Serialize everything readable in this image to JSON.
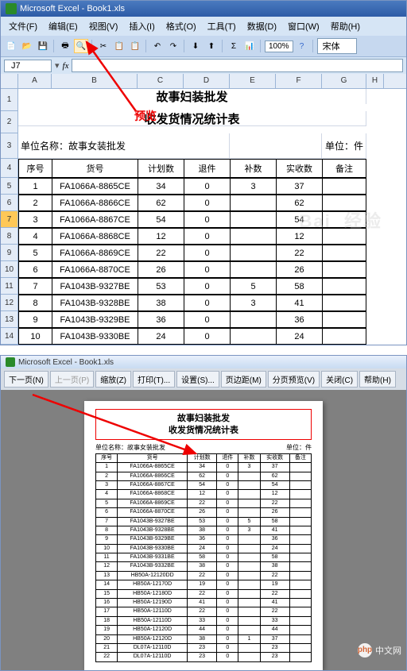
{
  "top": {
    "title": "Microsoft Excel - Book1.xls",
    "menu": [
      "文件(F)",
      "编辑(E)",
      "视图(V)",
      "插入(I)",
      "格式(O)",
      "工具(T)",
      "数据(D)",
      "窗口(W)",
      "帮助(H)"
    ],
    "zoom": "100%",
    "font": "宋体",
    "namebox": "J7",
    "cols": [
      "A",
      "B",
      "C",
      "D",
      "E",
      "F",
      "G",
      "H"
    ],
    "title1": "故事妇装批发",
    "title2": "收发货情况统计表",
    "unit_left": "单位名称：故事女装批发",
    "unit_right": "单位：件",
    "preview_label": "预览",
    "headers": [
      "序号",
      "货号",
      "计划数",
      "退件",
      "补数",
      "实收数",
      "备注"
    ],
    "rows": [
      {
        "rn": "5",
        "n": "1",
        "code": "FA1066A-8865CE",
        "plan": "34",
        "ret": "0",
        "add": "3",
        "recv": "37",
        "note": ""
      },
      {
        "rn": "6",
        "n": "2",
        "code": "FA1066A-8866CE",
        "plan": "62",
        "ret": "0",
        "add": "",
        "recv": "62",
        "note": ""
      },
      {
        "rn": "7",
        "n": "3",
        "code": "FA1066A-8867CE",
        "plan": "54",
        "ret": "0",
        "add": "",
        "recv": "54",
        "note": ""
      },
      {
        "rn": "8",
        "n": "4",
        "code": "FA1066A-8868CE",
        "plan": "12",
        "ret": "0",
        "add": "",
        "recv": "12",
        "note": ""
      },
      {
        "rn": "9",
        "n": "5",
        "code": "FA1066A-8869CE",
        "plan": "22",
        "ret": "0",
        "add": "",
        "recv": "22",
        "note": ""
      },
      {
        "rn": "10",
        "n": "6",
        "code": "FA1066A-8870CE",
        "plan": "26",
        "ret": "0",
        "add": "",
        "recv": "26",
        "note": ""
      },
      {
        "rn": "11",
        "n": "7",
        "code": "FA1043B-9327BE",
        "plan": "53",
        "ret": "0",
        "add": "5",
        "recv": "58",
        "note": ""
      },
      {
        "rn": "12",
        "n": "8",
        "code": "FA1043B-9328BE",
        "plan": "38",
        "ret": "0",
        "add": "3",
        "recv": "41",
        "note": ""
      },
      {
        "rn": "13",
        "n": "9",
        "code": "FA1043B-9329BE",
        "plan": "36",
        "ret": "0",
        "add": "",
        "recv": "36",
        "note": ""
      },
      {
        "rn": "14",
        "n": "10",
        "code": "FA1043B-9330BE",
        "plan": "24",
        "ret": "0",
        "add": "",
        "recv": "24",
        "note": ""
      }
    ]
  },
  "preview": {
    "title": "Microsoft Excel - Book1.xls",
    "buttons": [
      "下一页(N)",
      "上一页(P)",
      "缩放(Z)",
      "打印(T)...",
      "设置(S)...",
      "页边距(M)",
      "分页预览(V)",
      "关闭(C)",
      "帮助(H)"
    ],
    "page_title1": "故事妇装批发",
    "page_title2": "收发货情况统计表",
    "unit_left": "单位名称：故事女装批发",
    "unit_right": "单位：件",
    "headers": [
      "序号",
      "货号",
      "计划数",
      "退件",
      "补数",
      "实收数",
      "备注"
    ],
    "rows": [
      [
        "1",
        "FA1066A-8865CE",
        "34",
        "0",
        "3",
        "37",
        ""
      ],
      [
        "2",
        "FA1066A-8866CE",
        "62",
        "0",
        "",
        "62",
        ""
      ],
      [
        "3",
        "FA1066A-8867CE",
        "54",
        "0",
        "",
        "54",
        ""
      ],
      [
        "4",
        "FA1066A-8868CE",
        "12",
        "0",
        "",
        "12",
        ""
      ],
      [
        "5",
        "FA1066A-8869CE",
        "22",
        "0",
        "",
        "22",
        ""
      ],
      [
        "6",
        "FA1066A-8870CE",
        "26",
        "0",
        "",
        "26",
        ""
      ],
      [
        "7",
        "FA1043B-9327BE",
        "53",
        "0",
        "5",
        "58",
        ""
      ],
      [
        "8",
        "FA1043B-9328BE",
        "38",
        "0",
        "3",
        "41",
        ""
      ],
      [
        "9",
        "FA1043B-9329BE",
        "36",
        "0",
        "",
        "36",
        ""
      ],
      [
        "10",
        "FA1043B-9330BE",
        "24",
        "0",
        "",
        "24",
        ""
      ],
      [
        "11",
        "FA1043B-9331BE",
        "58",
        "0",
        "",
        "58",
        ""
      ],
      [
        "12",
        "FA1043B-9332BE",
        "38",
        "0",
        "",
        "38",
        ""
      ],
      [
        "13",
        "HB50A-12120DD",
        "22",
        "0",
        "",
        "22",
        ""
      ],
      [
        "14",
        "HB50A-12170D",
        "19",
        "0",
        "",
        "19",
        ""
      ],
      [
        "15",
        "HB50A-12180D",
        "22",
        "0",
        "",
        "22",
        ""
      ],
      [
        "16",
        "HB50A-12190D",
        "41",
        "0",
        "",
        "41",
        ""
      ],
      [
        "17",
        "HB50A-12110D",
        "22",
        "0",
        "",
        "22",
        ""
      ],
      [
        "18",
        "HB50A-12110D",
        "33",
        "0",
        "",
        "33",
        ""
      ],
      [
        "19",
        "HB50A-12120D",
        "44",
        "0",
        "",
        "44",
        ""
      ],
      [
        "20",
        "HB50A-12120D",
        "38",
        "0",
        "1",
        "37",
        ""
      ],
      [
        "21",
        "DL07A-12110D",
        "23",
        "0",
        "",
        "23",
        ""
      ],
      [
        "22",
        "DL07A-12110D",
        "23",
        "0",
        "",
        "23",
        ""
      ]
    ]
  },
  "watermark": "中文网"
}
